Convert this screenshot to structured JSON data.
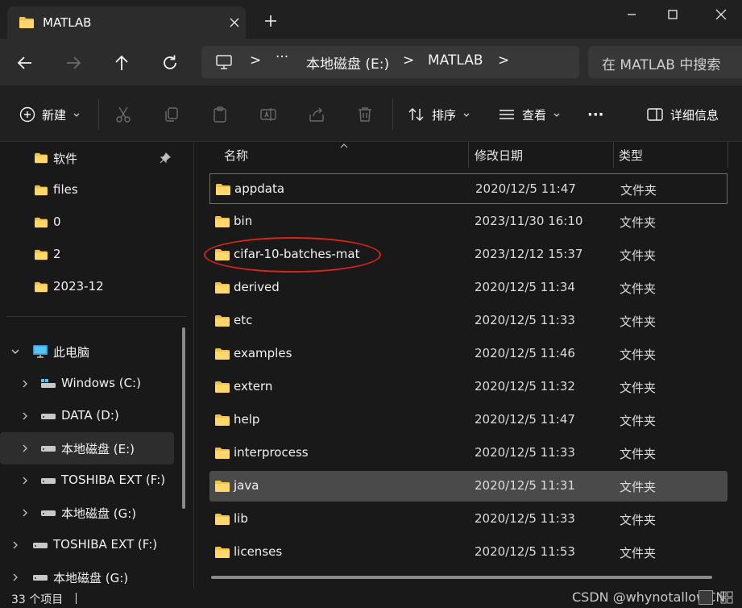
{
  "window": {
    "tab_title": "MATLAB",
    "icons": {
      "tab": "folder-icon",
      "close_tab": "close-icon",
      "new_tab": "plus-icon",
      "minimize": "minimize-icon",
      "maximize": "maximize-icon",
      "close": "close-icon"
    }
  },
  "address_bar": {
    "separator": ">",
    "overflow": "···",
    "crumbs": [
      "本地磁盘 (E:)",
      "MATLAB"
    ],
    "search_placeholder": "在 MATLAB 中搜索"
  },
  "command_bar": {
    "new_label": "新建",
    "sort_label": "排序",
    "view_label": "查看",
    "more_label": "···",
    "details_label": "详细信息"
  },
  "sidebar": {
    "quick_access": [
      {
        "label": "软件",
        "pinned": true
      },
      {
        "label": "files"
      },
      {
        "label": "0"
      },
      {
        "label": "2"
      },
      {
        "label": "2023-12"
      }
    ],
    "this_pc": {
      "label": "此电脑",
      "drives": [
        {
          "label": "Windows (C:)"
        },
        {
          "label": "DATA (D:)"
        },
        {
          "label": "本地磁盘 (E:)",
          "selected": true
        },
        {
          "label": "TOSHIBA EXT (F:)"
        },
        {
          "label": "本地磁盘 (G:)"
        }
      ]
    },
    "external": [
      {
        "label": "TOSHIBA EXT (F:)"
      },
      {
        "label": "本地磁盘 (G:)"
      }
    ]
  },
  "file_list": {
    "columns": {
      "name": "名称",
      "date": "修改日期",
      "type": "类型"
    },
    "rows": [
      {
        "name": "appdata",
        "date": "2020/12/5 11:47",
        "type": "文件夹"
      },
      {
        "name": "bin",
        "date": "2023/11/30 16:10",
        "type": "文件夹"
      },
      {
        "name": "cifar-10-batches-mat",
        "date": "2023/12/12 15:37",
        "type": "文件夹"
      },
      {
        "name": "derived",
        "date": "2020/12/5 11:34",
        "type": "文件夹"
      },
      {
        "name": "etc",
        "date": "2020/12/5 11:33",
        "type": "文件夹"
      },
      {
        "name": "examples",
        "date": "2020/12/5 11:46",
        "type": "文件夹"
      },
      {
        "name": "extern",
        "date": "2020/12/5 11:32",
        "type": "文件夹"
      },
      {
        "name": "help",
        "date": "2020/12/5 11:47",
        "type": "文件夹"
      },
      {
        "name": "interprocess",
        "date": "2020/12/5 11:33",
        "type": "文件夹"
      },
      {
        "name": "java",
        "date": "2020/12/5 11:31",
        "type": "文件夹"
      },
      {
        "name": "lib",
        "date": "2020/12/5 11:33",
        "type": "文件夹"
      },
      {
        "name": "licenses",
        "date": "2020/12/5 11:53",
        "type": "文件夹"
      }
    ]
  },
  "status_bar": {
    "item_count": "33 个项目",
    "watermark": "CSDN @whynotallowCN"
  },
  "colors": {
    "folder_yellow": "#f4c045",
    "annotation_red": "#d9231b",
    "accent_blue": "#4cc2ff"
  }
}
